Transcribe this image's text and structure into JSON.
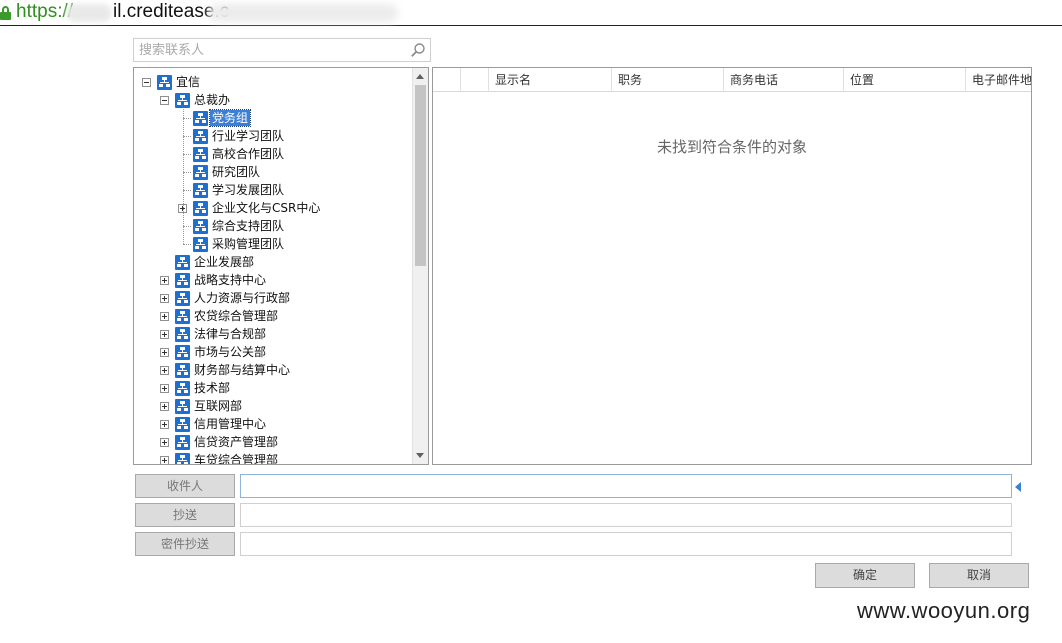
{
  "browser": {
    "url_scheme": "https://",
    "url_host": "il.creditease.c"
  },
  "search": {
    "placeholder": "搜索联系人"
  },
  "tree": {
    "root": "宜信",
    "group": "总裁办",
    "group_children": [
      "党务组",
      "行业学习团队",
      "高校合作团队",
      "研究团队",
      "学习发展团队",
      "企业文化与CSR中心",
      "综合支持团队",
      "采购管理团队"
    ],
    "selected": "党务组",
    "departments": [
      "企业发展部",
      "战略支持中心",
      "人力资源与行政部",
      "农贷综合管理部",
      "法律与合规部",
      "市场与公关部",
      "财务部与结算中心",
      "技术部",
      "互联网部",
      "信用管理中心",
      "信贷资产管理部",
      "车贷综合管理部"
    ]
  },
  "results": {
    "columns": [
      "显示名",
      "职务",
      "商务电话",
      "位置",
      "电子邮件地址"
    ],
    "empty_message": "未找到符合条件的对象"
  },
  "recipients": {
    "to_label": "收件人",
    "cc_label": "抄送",
    "bcc_label": "密件抄送",
    "to_value": "",
    "cc_value": "",
    "bcc_value": ""
  },
  "actions": {
    "ok": "确定",
    "cancel": "取消"
  },
  "watermark": "www.wooyun.org"
}
